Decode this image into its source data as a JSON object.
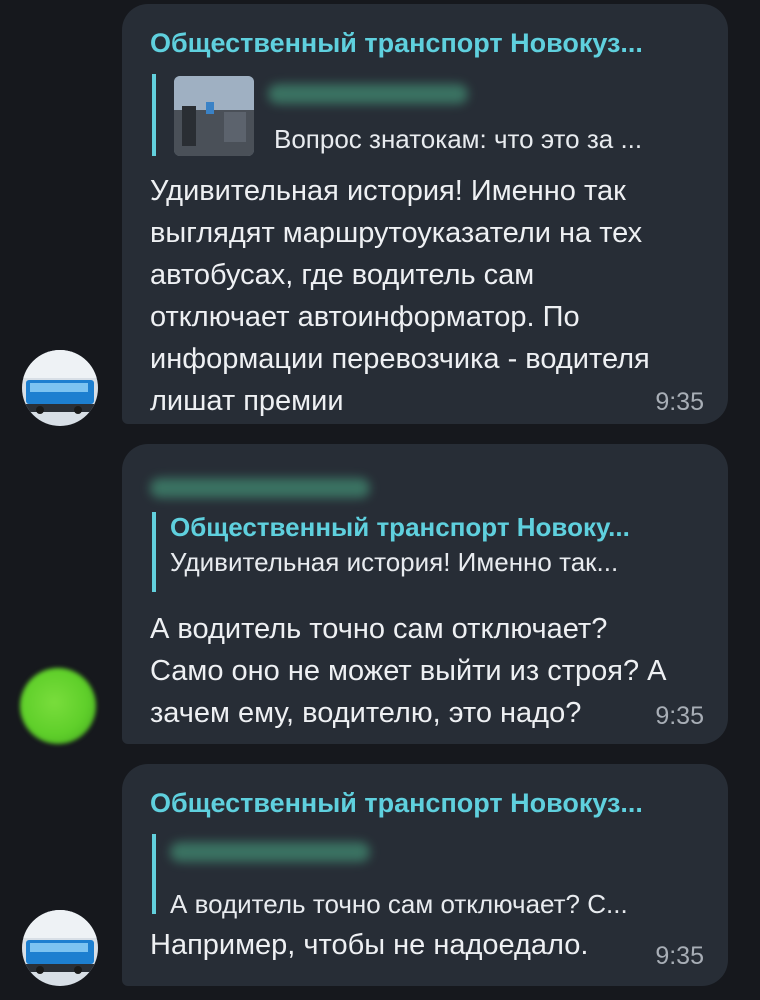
{
  "messages": [
    {
      "sender": "Общественный транспорт Новокуз...",
      "reply_text": "Вопрос знатокам: что это за ...",
      "text": "Удивительная история! Именно так\nвыглядят маршрутоуказатели на тех\nавтобусах, где водитель сам\nотключает автоинформатор. По\nинформации перевозчика - водителя\nлишат премии",
      "time": "9:35",
      "avatar_icon": "bus-photo-avatar"
    },
    {
      "reply_name": "Общественный транспорт Новоку...",
      "reply_text": "Удивительная история! Именно так...",
      "text": "А водитель точно сам отключает?\nСамо оно не может выйти из строя? А\nзачем ему, водителю, это надо?",
      "time": "9:35",
      "avatar_icon": "green-avatar"
    },
    {
      "sender": "Общественный транспорт Новокуз...",
      "reply_text": "А водитель точно сам отключает? С...",
      "text": "Например, чтобы не надоедало.",
      "time": "9:35",
      "avatar_icon": "bus-photo-avatar"
    }
  ],
  "colors": {
    "background": "#16181d",
    "bubble": "#272d36",
    "accent": "#5fd0de",
    "text": "#eef0f3",
    "time": "#a8aeb6"
  }
}
